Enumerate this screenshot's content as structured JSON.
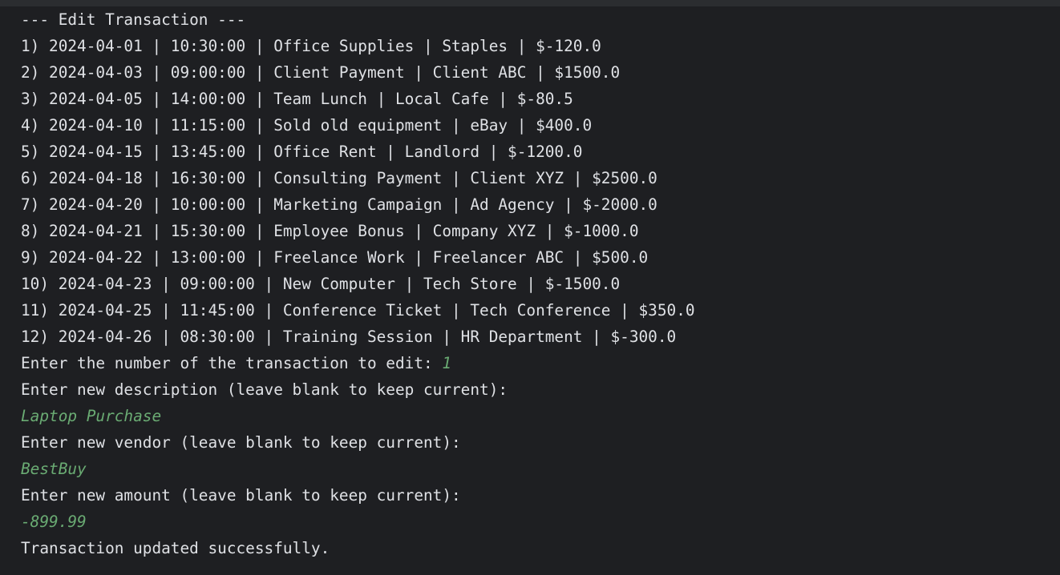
{
  "console": {
    "header": "--- Edit Transaction ---",
    "transactions": [
      "1) 2024-04-01 | 10:30:00 | Office Supplies | Staples | $-120.0",
      "2) 2024-04-03 | 09:00:00 | Client Payment | Client ABC | $1500.0",
      "3) 2024-04-05 | 14:00:00 | Team Lunch | Local Cafe | $-80.5",
      "4) 2024-04-10 | 11:15:00 | Sold old equipment | eBay | $400.0",
      "5) 2024-04-15 | 13:45:00 | Office Rent | Landlord | $-1200.0",
      "6) 2024-04-18 | 16:30:00 | Consulting Payment | Client XYZ | $2500.0",
      "7) 2024-04-20 | 10:00:00 | Marketing Campaign | Ad Agency | $-2000.0",
      "8) 2024-04-21 | 15:30:00 | Employee Bonus | Company XYZ | $-1000.0",
      "9) 2024-04-22 | 13:00:00 | Freelance Work | Freelancer ABC | $500.0",
      "10) 2024-04-23 | 09:00:00 | New Computer | Tech Store | $-1500.0",
      "11) 2024-04-25 | 11:45:00 | Conference Ticket | Tech Conference | $350.0",
      "12) 2024-04-26 | 08:30:00 | Training Session | HR Department | $-300.0"
    ],
    "prompt_number": "Enter the number of the transaction to edit: ",
    "input_number": "1",
    "prompt_description": "Enter new description (leave blank to keep current):",
    "input_description": "Laptop Purchase",
    "prompt_vendor": "Enter new vendor (leave blank to keep current):",
    "input_vendor": "BestBuy",
    "prompt_amount": "Enter new amount (leave blank to keep current):",
    "input_amount": "-899.99",
    "success_message": "Transaction updated successfully."
  },
  "colors": {
    "background": "#1e1f22",
    "text": "#dfe1e5",
    "user_input": "#6aab73"
  }
}
